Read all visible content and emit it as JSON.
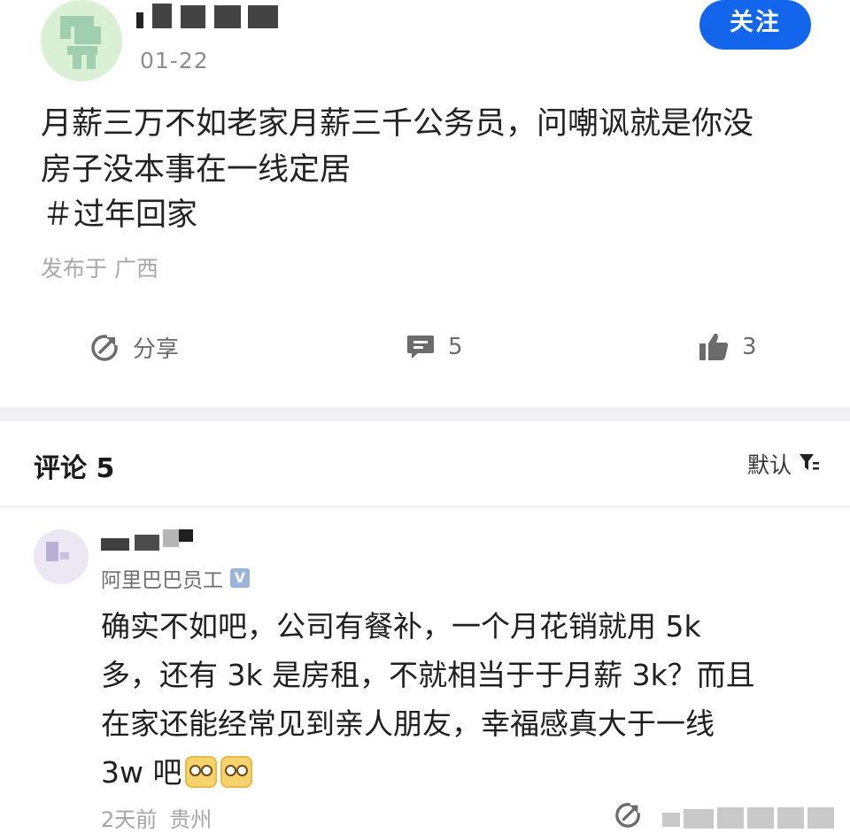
{
  "post": {
    "date": "01-22",
    "follow_label": "关注",
    "text_lines": [
      "月薪三万不如老家月薪三千公务员，问嘲讽就是你没",
      "房子没本事在一线定居"
    ],
    "tag": "＃过年回家",
    "location": "发布于 广西",
    "actions": {
      "share_label": "分享",
      "comments_count": "5",
      "likes_count": "3"
    }
  },
  "comments_section": {
    "title": "评论 5",
    "sort_label": "默认"
  },
  "comment": {
    "badge": "阿里巴巴员工",
    "verified_mark": "V",
    "text_lines": [
      "确实不如吧，公司有餐补，一个月花销就用 5k",
      "多，还有 3k 是房租，不就相当于于月薪 3k？而且",
      "在家还能经常见到亲人朋友，幸福感真大于一线",
      "3w 吧"
    ],
    "time": "2天前",
    "location": "贵州"
  },
  "icons": {
    "share": "share-icon",
    "comment": "comment-icon",
    "like": "thumbs-up-icon",
    "sort": "filter-icon",
    "emoji": "worried-face-emoji"
  },
  "colors": {
    "accent": "#1366ec",
    "meta_text": "#a8a8a8"
  }
}
